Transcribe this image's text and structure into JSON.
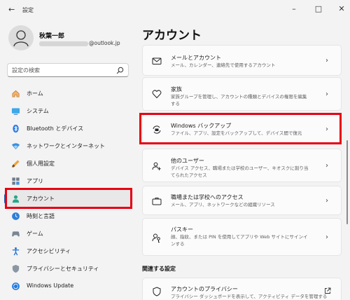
{
  "window": {
    "title": "設定",
    "controls": [
      "minimize-icon",
      "maximize-icon",
      "close-icon"
    ]
  },
  "profile": {
    "name": "秋葉一郎",
    "email_suffix": "@outlook.jp"
  },
  "search": {
    "placeholder": "設定の検索"
  },
  "sidebar": {
    "items": [
      {
        "label": "ホーム",
        "icon": "home-icon"
      },
      {
        "label": "システム",
        "icon": "system-icon"
      },
      {
        "label": "Bluetooth とデバイス",
        "icon": "bluetooth-icon"
      },
      {
        "label": "ネットワークとインターネット",
        "icon": "network-icon"
      },
      {
        "label": "個人用設定",
        "icon": "brush-icon"
      },
      {
        "label": "アプリ",
        "icon": "apps-icon"
      },
      {
        "label": "アカウント",
        "icon": "account-icon",
        "selected": true
      },
      {
        "label": "時刻と言語",
        "icon": "time-language-icon"
      },
      {
        "label": "ゲーム",
        "icon": "gaming-icon"
      },
      {
        "label": "アクセシビリティ",
        "icon": "accessibility-icon"
      },
      {
        "label": "プライバシーとセキュリティ",
        "icon": "shield-icon"
      },
      {
        "label": "Windows Update",
        "icon": "windows-update-icon"
      }
    ]
  },
  "main": {
    "title": "アカウント",
    "cards": [
      {
        "title": "メールとアカウント",
        "desc": "メール、カレンダー、連絡先で使用するアカウント",
        "icon": "mail-icon"
      },
      {
        "title": "家族",
        "desc": "家族グループを管理し、アカウントの種類とデバイスの権限を編集する",
        "icon": "family-icon"
      },
      {
        "title": "Windows バックアップ",
        "desc": "ファイル、アプリ、設定をバックアップして、デバイス間で復元",
        "icon": "backup-icon"
      },
      {
        "title": "他のユーザー",
        "desc": "デバイス アクセス、職場または学校のユーザー、キオスクに割り当てられたアクセス",
        "icon": "other-users-icon"
      },
      {
        "title": "職場または学校へのアクセス",
        "desc": "メール、アプリ、ネットワークなどの組織リソース",
        "icon": "briefcase-icon"
      },
      {
        "title": "パスキー",
        "desc": "顔、指紋、または PIN を使用してアプリや Web サイトにサインインする",
        "icon": "passkey-icon"
      }
    ],
    "related_section": "関連する設定",
    "related_cards": [
      {
        "title": "アカウントのプライバシー",
        "desc": "プライバシー ダッシュボードを表示して、アクティビティ データを管理する",
        "icon": "privacy-shield-icon",
        "action_icon": "external-link-icon"
      }
    ]
  },
  "colors": {
    "highlight": "#e60012",
    "accent": "#0067c0"
  }
}
